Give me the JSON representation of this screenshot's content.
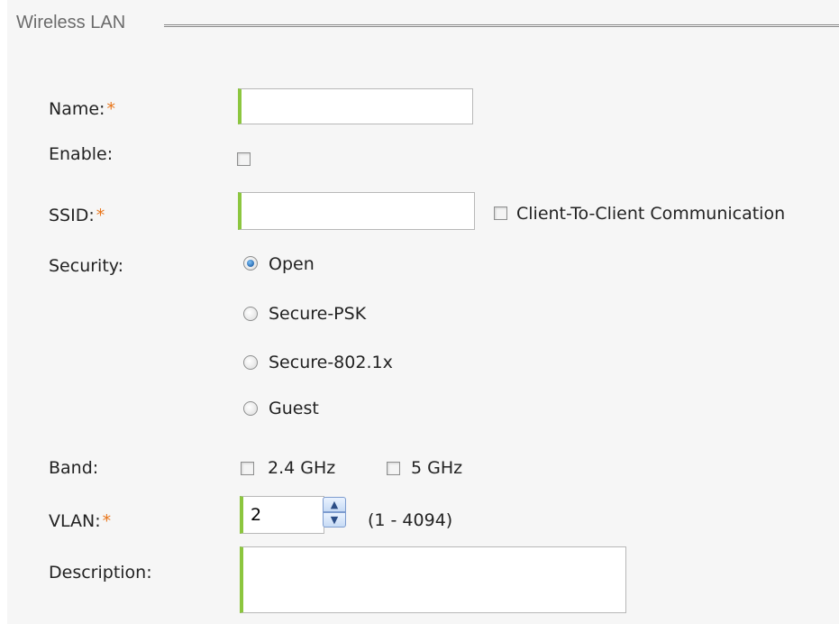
{
  "fieldset": {
    "legend": "Wireless LAN"
  },
  "form": {
    "name": {
      "label": "Name:",
      "required_mark": "*",
      "value": ""
    },
    "enable": {
      "label": "Enable:",
      "checked": false
    },
    "ssid": {
      "label": "SSID:",
      "required_mark": "*",
      "value": ""
    },
    "client_to_client": {
      "label": "Client-To-Client Communication",
      "checked": false
    },
    "security": {
      "label": "Security:",
      "options": [
        "Open",
        "Secure-PSK",
        "Secure-802.1x",
        "Guest"
      ],
      "selected": "Open"
    },
    "band": {
      "label": "Band:",
      "options": [
        {
          "label": "2.4 GHz",
          "checked": false
        },
        {
          "label": "5 GHz",
          "checked": false
        }
      ]
    },
    "vlan": {
      "label": "VLAN:",
      "required_mark": "*",
      "value": "2",
      "range_hint": "(1 - 4094)"
    },
    "description": {
      "label": "Description:",
      "value": ""
    }
  },
  "colors": {
    "required": "#e8751a",
    "input_accent": "#8cc63f",
    "radio_selected": "#1e5fa8"
  },
  "icons": {
    "spin_up": "up-arrow-icon",
    "spin_down": "down-arrow-icon"
  }
}
